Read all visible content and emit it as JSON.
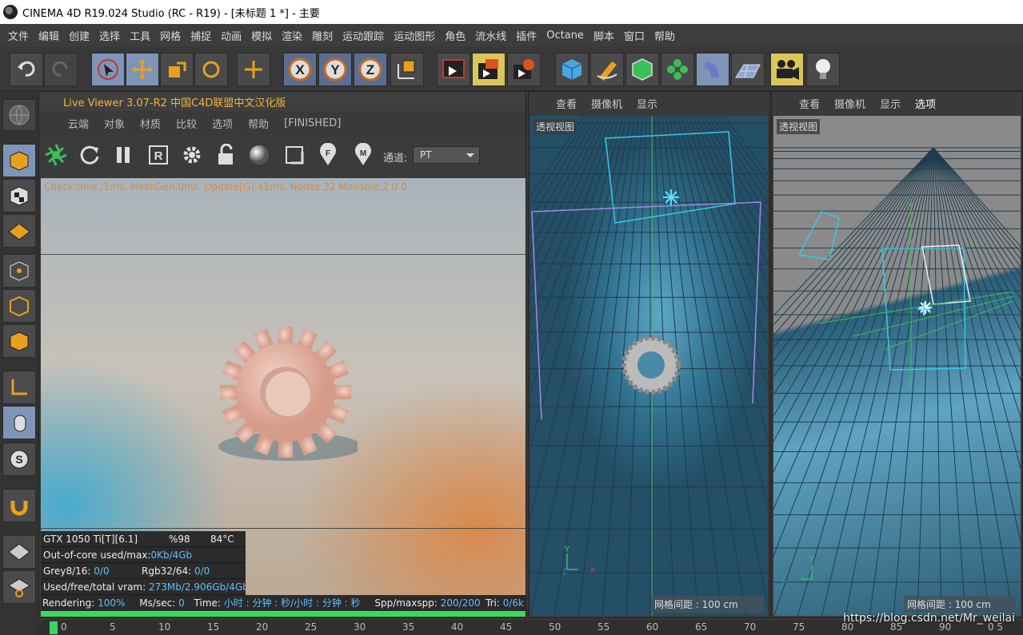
{
  "window": {
    "title": "CINEMA 4D R19.024 Studio (RC - R19) - [未标题 1 *] - 主要"
  },
  "menubar": [
    "文件",
    "编辑",
    "创建",
    "选择",
    "工具",
    "网格",
    "捕捉",
    "动画",
    "模拟",
    "渲染",
    "雕刻",
    "运动跟踪",
    "运动图形",
    "角色",
    "流水线",
    "插件",
    "Octane",
    "脚本",
    "窗口",
    "帮助"
  ],
  "toolbar": {
    "x_label": "X",
    "y_label": "Y",
    "z_label": "Z"
  },
  "live_viewer": {
    "title": "Live Viewer 3.07-R2 中国C4D联盟中文汉化版",
    "menu": [
      "云端",
      "对象",
      "材质",
      "比较",
      "选项",
      "帮助",
      "[FINISHED]"
    ],
    "channel_label": "通道:",
    "channel_value": "PT",
    "check_line": "Check:0ms./1ms. MeshGen:0ms. Update[G]:41ms. Nodes:32 Movable:2  0 0",
    "stats": {
      "gpu": "GTX 1050 Ti[T][6.1]",
      "gpu_pct": "%98",
      "gpu_temp": "84°C",
      "ooc_label": "Out-of-core used/max:",
      "ooc_value": "0Kb/4Gb",
      "grey_label": "Grey8/16:",
      "grey_value": "0/0",
      "rgb_label": "Rgb32/64:",
      "rgb_value": "0/0",
      "vram_label": "Used/free/total vram:",
      "vram_value": "273Mb/2.906Gb/4Gb"
    },
    "render_bar": {
      "rendering_label": "Rendering:",
      "rendering_value": "100%",
      "mssec_label": "Ms/sec:",
      "mssec_value": "0",
      "time_label": "Time:",
      "time_value": "小时 : 分钟 : 秒/小时 : 分钟 : 秒",
      "spp_label": "Spp/maxspp:",
      "spp_value": "200/200",
      "tri_label": "Tri:",
      "tri_value": "0/6k"
    },
    "progress": 1.0
  },
  "viewport_a": {
    "menu": [
      "查看",
      "摄像机",
      "显示"
    ],
    "label": "透视视图",
    "grid_spacing": "网格间距 : 100 cm"
  },
  "viewport_b": {
    "menu": [
      "查看",
      "摄像机",
      "显示",
      "选项"
    ],
    "label": "透视视图",
    "grid_spacing": "网格间距 : 100 cm"
  },
  "timeline": {
    "ticks": [
      "0",
      "5",
      "10",
      "15",
      "20",
      "25",
      "30",
      "35",
      "40",
      "45",
      "50",
      "55",
      "60",
      "65",
      "70",
      "75",
      "80",
      "85",
      "90",
      "0 5"
    ]
  },
  "watermark": "https://blog.csdn.net/Mr_weilai"
}
